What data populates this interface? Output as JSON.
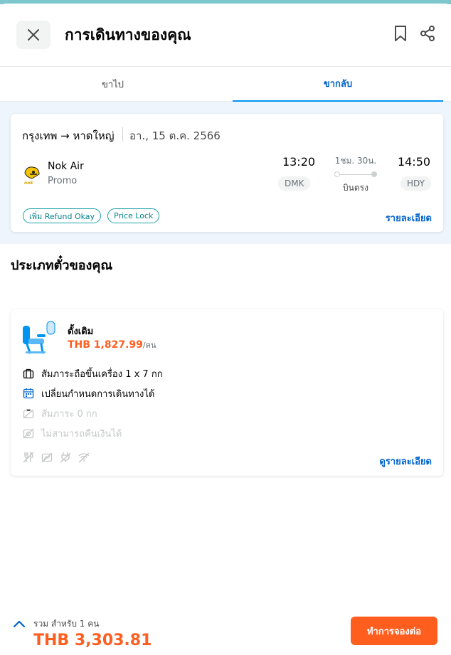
{
  "header": {
    "title": "การเดินทางของคุณ"
  },
  "tabs": [
    {
      "label": "ขาไป"
    },
    {
      "label": "ขากลับ"
    }
  ],
  "flight": {
    "route": "กรุงเทพ → หาดใหญ่",
    "date": "อา., 15 ต.ค. 2566",
    "airline": "Nok Air",
    "fare_class": "Promo",
    "depart_time": "13:20",
    "arrive_time": "14:50",
    "depart_code": "DMK",
    "arrive_code": "HDY",
    "duration": "1ชม. 30น.",
    "stops": "บินตรง",
    "tags": [
      "เพิ่ม Refund Okay",
      "Price Lock"
    ],
    "details_link": "รายละเอียด"
  },
  "ticket": {
    "section_title": "ประเภทตั๋วของคุณ",
    "fare_name": "ดั้งเดิม",
    "price": "THB 1,827.99",
    "per_person": "/คน",
    "features": [
      {
        "text": "สัมภาระถือขึ้นเครื่อง 1 x 7 กก",
        "available": true,
        "icon": "cabin-bag-icon"
      },
      {
        "text": "เปลี่ยนกำหนดการเดินทางได้",
        "available": true,
        "icon": "calendar-icon"
      },
      {
        "text": "สัมภาระ 0 กก",
        "available": false,
        "icon": "baggage-icon"
      },
      {
        "text": "ไม่สามารถคืนเงินได้",
        "available": false,
        "icon": "refund-icon"
      }
    ],
    "details_link": "ดูรายละเอียด"
  },
  "footer": {
    "total_label": "รวม สำหรับ 1 คน",
    "total_price": "THB 3,303.81",
    "book_button": "ทำการจองต่อ"
  },
  "colors": {
    "accent_blue": "#0264c8",
    "tab_underline": "#0194f3",
    "price_orange": "#ff5e1f",
    "tag_teal": "#1ba0a7"
  }
}
